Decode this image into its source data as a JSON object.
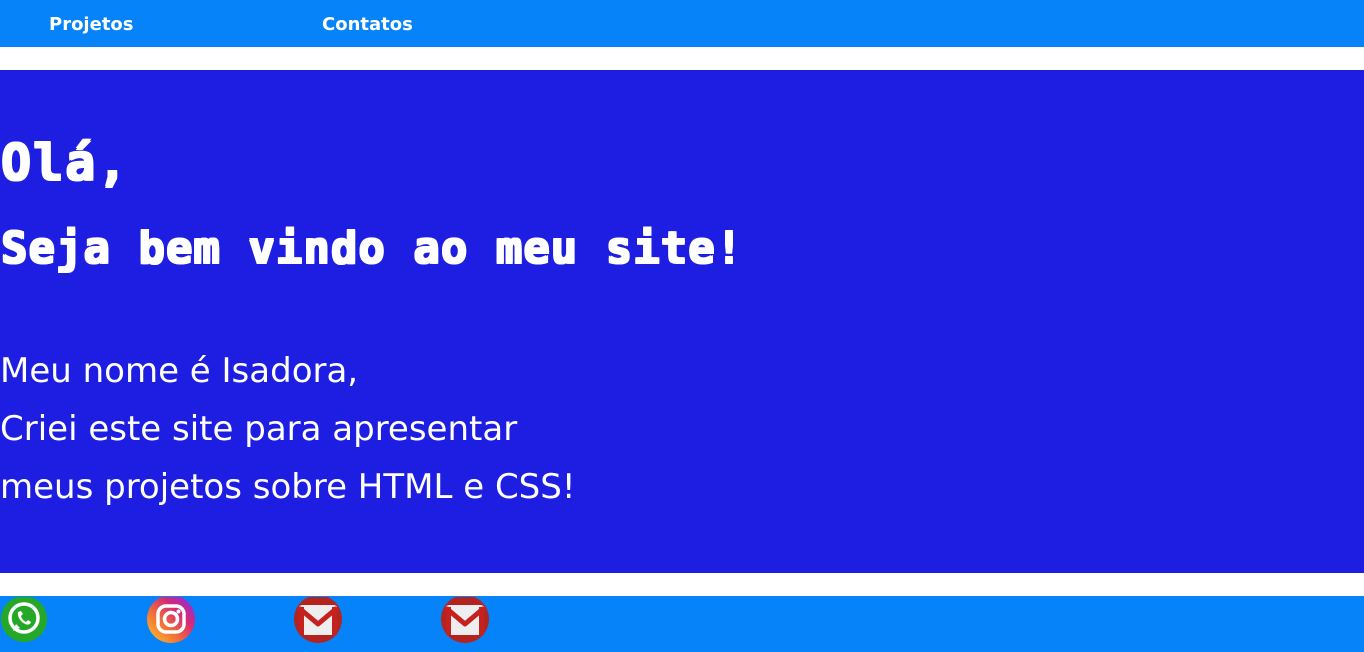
{
  "nav": {
    "items": [
      {
        "label": "Projetos"
      },
      {
        "label": "Contatos"
      }
    ],
    "background": "#0683f8"
  },
  "hero": {
    "greeting": "Olá,",
    "welcome": "Seja bem vindo ao meu site!",
    "intro_lines": [
      "Meu nome é Isadora,",
      "Criei este site para apresentar",
      "meus projetos sobre HTML e CSS!"
    ],
    "background": "#1e1ee3",
    "text_color": "#ffffff"
  },
  "footer": {
    "background": "#0683f8",
    "icons": [
      {
        "name": "whatsapp-icon",
        "color": "#25a827"
      },
      {
        "name": "instagram-icon",
        "color": "#d62976"
      },
      {
        "name": "gmail-icon",
        "color": "#c5221f"
      },
      {
        "name": "gmail-icon",
        "color": "#c5221f"
      }
    ]
  }
}
